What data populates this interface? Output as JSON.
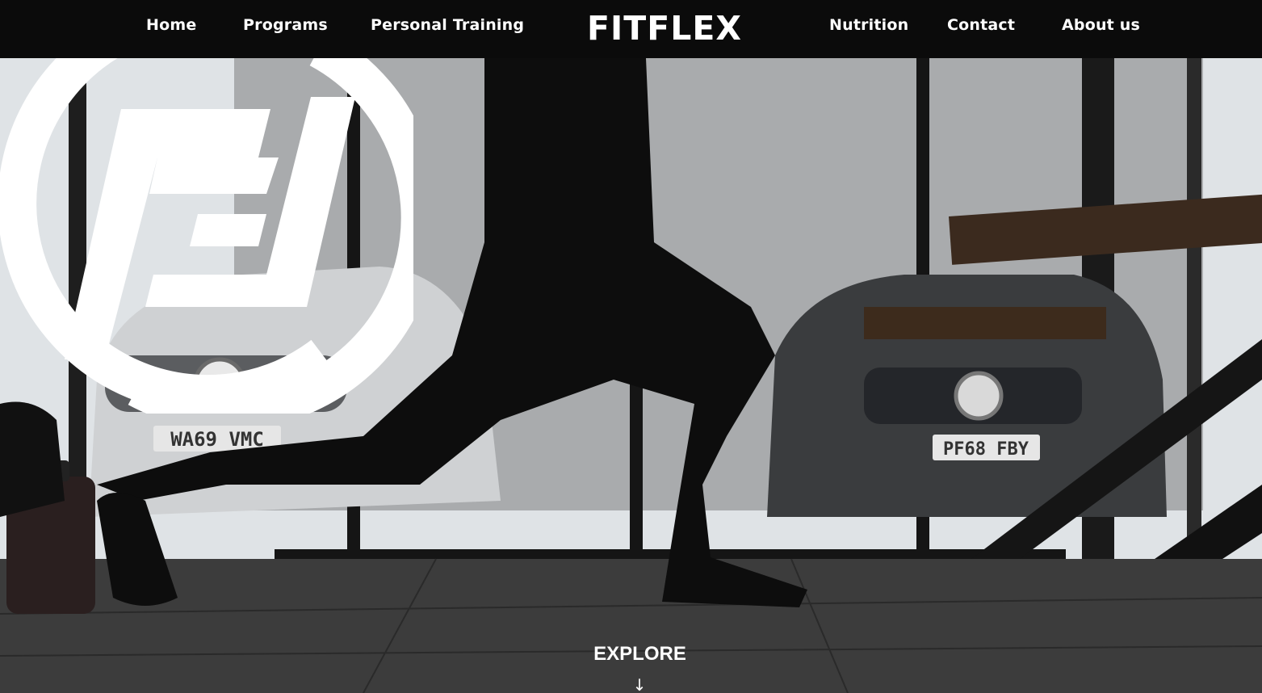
{
  "nav": {
    "left_links": [
      "Home",
      "Programs",
      "Personal Training"
    ],
    "brand": "FITFLEX",
    "right_links": [
      "Nutrition",
      "Contact",
      "About us"
    ]
  },
  "hero": {
    "logo_icon": "fitflex-emblem-icon",
    "plate_left": "WA69 VMC",
    "plate_right": "PF68 FBY",
    "cta_label": "EXPLORE",
    "cta_arrow": "↓"
  },
  "colors": {
    "nav_bg": "#0b0b0b",
    "text": "#ffffff"
  }
}
